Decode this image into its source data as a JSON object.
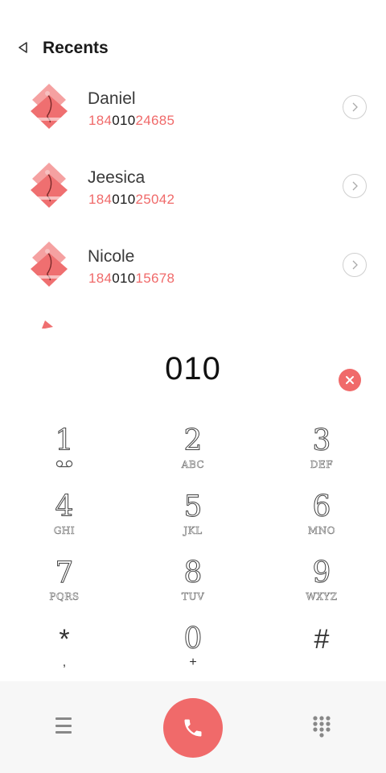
{
  "header": {
    "title": "Recents",
    "back_icon": "back-triangle-icon"
  },
  "recents": [
    {
      "name": "Daniel",
      "number_prefix": "184",
      "number_match": "010",
      "number_suffix": "24685"
    },
    {
      "name": "Jeesica",
      "number_prefix": "184",
      "number_match": "010",
      "number_suffix": "25042"
    },
    {
      "name": "Nicole",
      "number_prefix": "184",
      "number_match": "010",
      "number_suffix": "15678"
    }
  ],
  "dial": {
    "entered": "010"
  },
  "keypad": [
    {
      "digit": "1",
      "letters": ""
    },
    {
      "digit": "2",
      "letters": "ABC"
    },
    {
      "digit": "3",
      "letters": "DEF"
    },
    {
      "digit": "4",
      "letters": "GHI"
    },
    {
      "digit": "5",
      "letters": "JKL"
    },
    {
      "digit": "6",
      "letters": "MNO"
    },
    {
      "digit": "7",
      "letters": "PQRS"
    },
    {
      "digit": "8",
      "letters": "TUV"
    },
    {
      "digit": "9",
      "letters": "WXYZ"
    },
    {
      "digit": "*",
      "letters": ","
    },
    {
      "digit": "0",
      "letters": "+"
    },
    {
      "digit": "#",
      "letters": ""
    }
  ],
  "colors": {
    "accent": "#f06a6a",
    "bottom_bar": "#f7f7f7"
  }
}
